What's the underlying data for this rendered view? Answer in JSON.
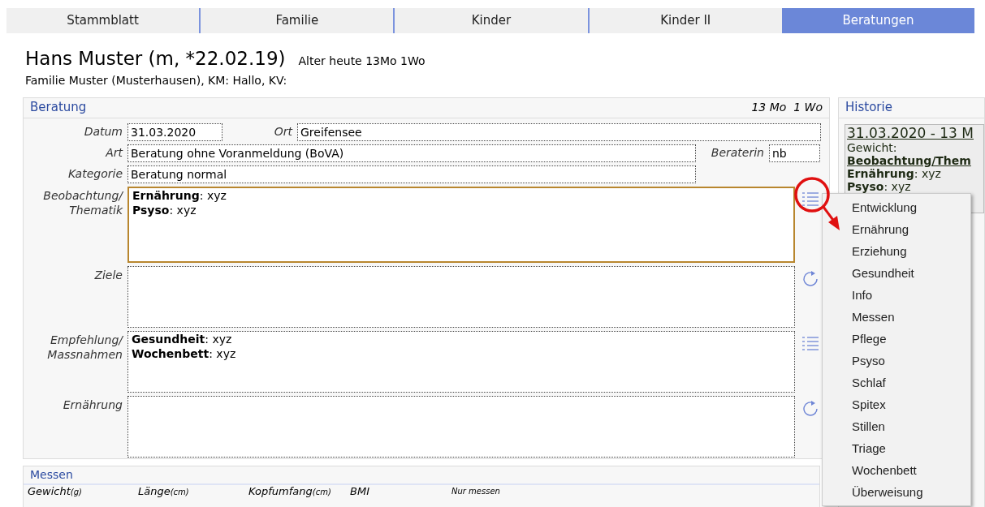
{
  "tabs": [
    {
      "label": "Stammblatt",
      "selected": false
    },
    {
      "label": "Familie",
      "selected": false
    },
    {
      "label": "Kinder",
      "selected": false
    },
    {
      "label": "Kinder II",
      "selected": false
    },
    {
      "label": "Beratungen",
      "selected": true
    }
  ],
  "header": {
    "name": "Hans Muster (m, *22.02.19)",
    "age": "Alter heute 13Mo 1Wo",
    "family": "Familie Muster (Musterhausen), KM: Hallo, KV:"
  },
  "beratung": {
    "title": "Beratung",
    "age": "13 Mo  1 Wo",
    "datum": {
      "label": "Datum",
      "value": "31.03.2020"
    },
    "ort": {
      "label": "Ort",
      "value": "Greifensee"
    },
    "art": {
      "label": "Art",
      "value": "Beratung ohne Voranmeldung (BoVA)"
    },
    "beraterin": {
      "label": "Beraterin",
      "value": "nb"
    },
    "kategorie": {
      "label": "Kategorie",
      "value": "Beratung normal"
    },
    "areas": [
      {
        "label": "Beobachtung/ Thematik",
        "lines": [
          "**Ernährung**: xyz",
          "**Psyso**: xyz"
        ],
        "focused": true,
        "kind": "list"
      },
      {
        "label": "Ziele",
        "focused": false,
        "kind": "refresh"
      },
      {
        "label": "Empfehlung/ Massnahmen",
        "lines": [
          "**Gesundheit**: xyz",
          "**Wochenbett**: xyz"
        ],
        "focused": false,
        "kind": "list"
      },
      {
        "label": "Ernährung",
        "focused": false,
        "kind": "refresh"
      }
    ]
  },
  "messen": {
    "title": "Messen",
    "columns": [
      {
        "label": "Gewicht",
        "unit": "(g)"
      },
      {
        "label": "Länge",
        "unit": "(cm)"
      },
      {
        "label": "Kopfumfang",
        "unit": "(cm)"
      },
      {
        "label": "BMI"
      }
    ],
    "button": "Nur messen"
  },
  "historie": {
    "title": "Historie",
    "entry_title": "31.03.2020 - 13 M",
    "lines": [
      "Gewicht:",
      "**Beobachtung/Them**",
      "**Ernährung**: xyz",
      "**Psyso**: xyz"
    ]
  },
  "menu": {
    "items": [
      "Entwicklung",
      "Ernährung",
      "Erziehung",
      "Gesundheit",
      "Info",
      "Messen",
      "Pflege",
      "Psyso",
      "Schlaf",
      "Spitex",
      "Stillen",
      "Triage",
      "Wochenbett",
      "Überweisung"
    ]
  }
}
